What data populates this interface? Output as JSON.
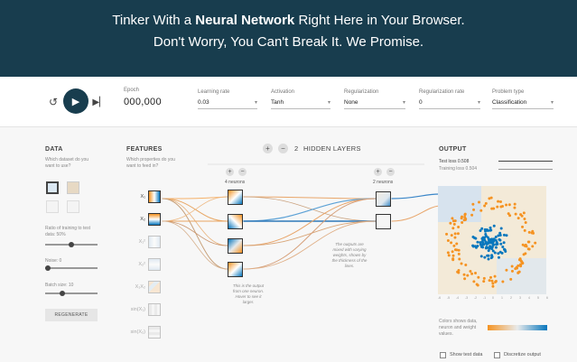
{
  "banner": {
    "line1_pre": "Tinker With a ",
    "line1_bold": "Neural Network",
    "line1_post": " Right Here in Your Browser.",
    "line2": "Don't Worry, You Can't Break It. We Promise."
  },
  "topbar": {
    "epoch_label": "Epoch",
    "epoch_value": "000,000",
    "learning_rate": {
      "label": "Learning rate",
      "value": "0.03"
    },
    "activation": {
      "label": "Activation",
      "value": "Tanh"
    },
    "regularization": {
      "label": "Regularization",
      "value": "None"
    },
    "regularization_rate": {
      "label": "Regularization rate",
      "value": "0"
    },
    "problem_type": {
      "label": "Problem type",
      "value": "Classification"
    }
  },
  "data_panel": {
    "title": "DATA",
    "subtitle": "Which dataset do you want to use?",
    "ratio_label": "Ratio of training to test data:  50%",
    "ratio_value": 0.5,
    "noise_label": "Noise:  0",
    "noise_value": 0,
    "batch_label": "Batch size:  10",
    "batch_value": 0.3,
    "regenerate": "REGENERATE"
  },
  "features_panel": {
    "title": "FEATURES",
    "subtitle": "Which properties do you want to feed in?",
    "items": [
      {
        "label": "X₁",
        "on": true
      },
      {
        "label": "X₂",
        "on": true
      },
      {
        "label": "X₁²",
        "on": false
      },
      {
        "label": "X₂²",
        "on": false
      },
      {
        "label": "X₁X₂",
        "on": false
      },
      {
        "label": "sin(X₁)",
        "on": false
      },
      {
        "label": "sin(X₂)",
        "on": false
      }
    ]
  },
  "hidden": {
    "count": "2",
    "title": "HIDDEN LAYERS",
    "layer1_label": "4 neurons",
    "layer2_label": "2 neurons",
    "note1": "This is the output from one neuron. Hover to see it larger.",
    "note2": "The outputs are mixed with varying weights, shown by the thickness of the lines."
  },
  "output": {
    "title": "OUTPUT",
    "test_loss": "Test loss 0.508",
    "train_loss": "Training loss 0.504",
    "legend_text": "Colors shows data, neuron and weight values.",
    "show_test": "Show test data",
    "discretize": "Discretize output",
    "axis_ticks": [
      "-6",
      "-5",
      "-4",
      "-3",
      "-2",
      "-1",
      "0",
      "1",
      "2",
      "3",
      "4",
      "5",
      "6"
    ]
  },
  "colors": {
    "banner": "#183d4e",
    "orange": "#f59322",
    "blue": "#0877bd"
  },
  "icons": {
    "reset": "reset-icon",
    "play": "play-icon",
    "step": "step-forward-icon"
  }
}
